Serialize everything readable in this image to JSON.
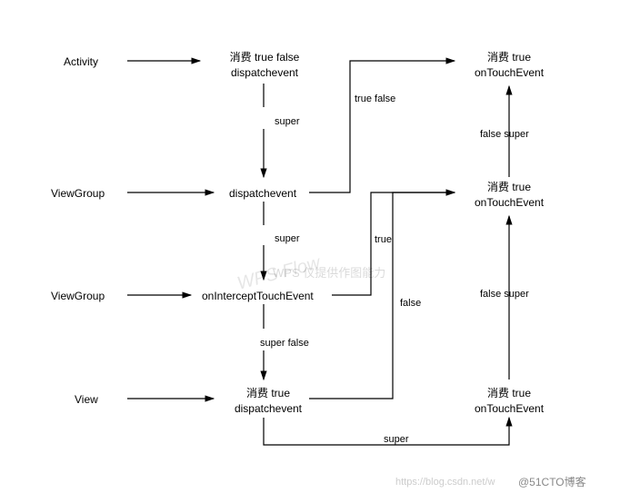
{
  "nodes": {
    "activity_label": "Activity",
    "viewgroup1_label": "ViewGroup",
    "viewgroup2_label": "ViewGroup",
    "view_label": "View",
    "activity_dispatch_l1": "消费 true false",
    "activity_dispatch_l2": "dispatchevent",
    "viewgroup_dispatch": "dispatchevent",
    "viewgroup_intercept": "onInterceptTouchEvent",
    "view_dispatch_l1": "消费 true",
    "view_dispatch_l2": "dispatchevent",
    "activity_touch_l1": "消费 true",
    "activity_touch_l2": "onTouchEvent",
    "viewgroup_touch_l1": "消费 true",
    "viewgroup_touch_l2": "onTouchEvent",
    "view_touch_l1": "消费 true",
    "view_touch_l2": "onTouchEvent"
  },
  "edges": {
    "super1": "super",
    "super2": "super",
    "super_false": "super false",
    "super3": "super",
    "true_false1": "true false",
    "true1": "true",
    "false1": "false",
    "false_super1": "false super",
    "false_super2": "false super"
  },
  "watermarks": {
    "wps": "WPS Flow",
    "wps_sub": "WPS 仅提供作图能力",
    "csdn": "https://blog.csdn.net/w",
    "attribution": "@51CTO博客"
  },
  "chart_data": {
    "type": "diagram",
    "title": "Android Touch Event Dispatch Flow",
    "rows": [
      {
        "level": "Activity",
        "dispatch": "消费 true false / dispatchevent",
        "touch": "消费 true / onTouchEvent"
      },
      {
        "level": "ViewGroup",
        "dispatch": "dispatchevent",
        "touch": "消费 true / onTouchEvent"
      },
      {
        "level": "ViewGroup",
        "dispatch": "onInterceptTouchEvent",
        "touch": ""
      },
      {
        "level": "View",
        "dispatch": "消费 true / dispatchevent",
        "touch": "消费 true / onTouchEvent"
      }
    ],
    "flows": [
      {
        "from": "Activity.dispatchevent",
        "to": "ViewGroup.dispatchevent",
        "label": "super"
      },
      {
        "from": "ViewGroup.dispatchevent",
        "to": "ViewGroup.onInterceptTouchEvent",
        "label": "super"
      },
      {
        "from": "ViewGroup.onInterceptTouchEvent",
        "to": "View.dispatchevent",
        "label": "super false"
      },
      {
        "from": "View.dispatchevent",
        "to": "View.onTouchEvent",
        "label": "super"
      },
      {
        "from": "ViewGroup.dispatchevent",
        "to": "Activity.onTouchEvent",
        "label": "true false"
      },
      {
        "from": "ViewGroup.onInterceptTouchEvent",
        "to": "ViewGroup.onTouchEvent",
        "label": "true"
      },
      {
        "from": "View.dispatchevent",
        "to": "ViewGroup.onTouchEvent",
        "label": "false"
      },
      {
        "from": "View.onTouchEvent",
        "to": "ViewGroup.onTouchEvent",
        "label": "false super"
      },
      {
        "from": "ViewGroup.onTouchEvent",
        "to": "Activity.onTouchEvent",
        "label": "false super"
      }
    ]
  }
}
